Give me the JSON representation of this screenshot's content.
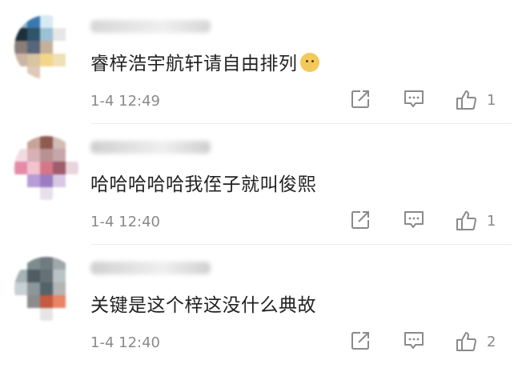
{
  "comments": [
    {
      "text": "睿梓浩宇航轩请自由排列",
      "time": "1-4 12:49",
      "likes": "1",
      "has_emoji": true,
      "avatar_colors": [
        "#8fb0c8",
        "#3b78b0",
        "#d8eaf3",
        "#ffffff",
        "#ffffff",
        "#1d2f3a",
        "#2f5568",
        "#9bc1d6",
        "#e6e6e6",
        "#ffffff",
        "#8a7f78",
        "#59657a",
        "#c7b09a",
        "#ffffff",
        "#ffffff",
        "#cbb5a5",
        "#d8c4a0",
        "#f2d68a",
        "#efe0b5",
        "#ffffff",
        "#ffffff",
        "#e0c8b8",
        "#ffffff",
        "#ffffff",
        "#ffffff"
      ],
      "name_color": "#d6d6d6"
    },
    {
      "text": "哈哈哈哈哈我侄子就叫俊熙",
      "time": "1-4 12:40",
      "likes": "1",
      "has_emoji": false,
      "avatar_colors": [
        "#ffffff",
        "#c7a49a",
        "#8e5a52",
        "#d2bdb6",
        "#ffffff",
        "#f2dce2",
        "#d8b0b6",
        "#b89292",
        "#c6a6ab",
        "#ffffff",
        "#e78aa8",
        "#f2c2cf",
        "#d47789",
        "#a05b6c",
        "#e9d6dd",
        "#ffffff",
        "#b89cd6",
        "#9b7cc0",
        "#d8c8e4",
        "#ffffff",
        "#ffffff",
        "#ffffff",
        "#e8dfec",
        "#ffffff",
        "#ffffff"
      ],
      "name_color": "#cfcfcf"
    },
    {
      "text": "关键是这个梓这没什么典故",
      "time": "1-4 12:40",
      "likes": "2",
      "has_emoji": false,
      "avatar_colors": [
        "#ffffff",
        "#7e8c90",
        "#6f7b80",
        "#9fa9ad",
        "#ffffff",
        "#a5b2b6",
        "#4f5c63",
        "#657176",
        "#b9c2c5",
        "#ffffff",
        "#c7d0d2",
        "#8b979b",
        "#55626a",
        "#b4b4b4",
        "#ffffff",
        "#ffffff",
        "#8c8c8c",
        "#c45a42",
        "#e88566",
        "#ffffff",
        "#ffffff",
        "#ffffff",
        "#e5e5e5",
        "#ffffff",
        "#ffffff"
      ],
      "name_color": "#d0d0d0"
    }
  ],
  "icons": {
    "forward": "share-forward-icon",
    "reply": "comment-icon",
    "like": "thumbs-up-icon"
  },
  "icon_color": "#8a8a8a"
}
